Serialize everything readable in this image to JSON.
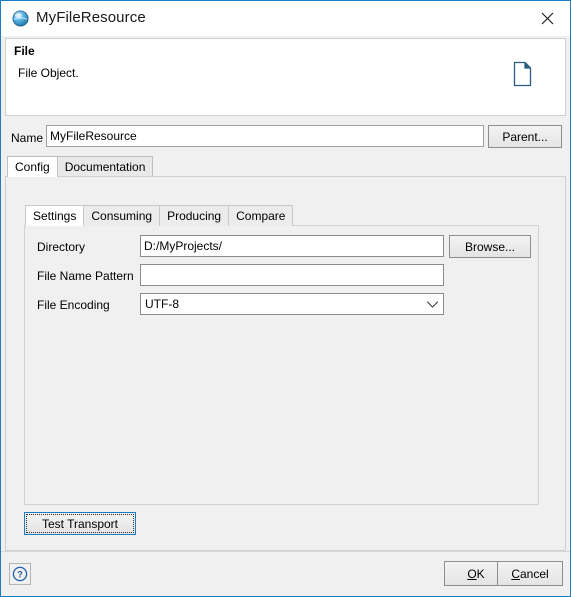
{
  "window": {
    "title": "MyFileResource",
    "icon": "blue-sphere-icon",
    "close_label": "✕",
    "border_color": "#1a7dc4"
  },
  "header": {
    "title": "File",
    "description": "File Object.",
    "icon": "document-page-icon"
  },
  "name_row": {
    "label": "Name",
    "value": "MyFileResource",
    "placeholder": "",
    "parent_button": "Parent..."
  },
  "outer_tabs": [
    {
      "label": "Config",
      "selected": true
    },
    {
      "label": "Documentation",
      "selected": false
    }
  ],
  "inner_tabs": [
    {
      "label": "Settings",
      "selected": true
    },
    {
      "label": "Consuming",
      "selected": false
    },
    {
      "label": "Producing",
      "selected": false
    },
    {
      "label": "Compare",
      "selected": false
    }
  ],
  "settings": {
    "directory": {
      "label": "Directory",
      "value": "D:/MyProjects/",
      "placeholder": "",
      "browse_button": "Browse..."
    },
    "file_name_pattern": {
      "label": "File Name Pattern",
      "value": "",
      "placeholder": ""
    },
    "file_encoding": {
      "label": "File Encoding",
      "value": "UTF-8",
      "arrow_icon": "chevron-down-icon",
      "options": [
        "UTF-8"
      ]
    }
  },
  "test_transport_button": "Test Transport",
  "footer": {
    "help_icon": "help-question-icon",
    "ok": {
      "mnemonic": "O",
      "rest": "K"
    },
    "cancel": {
      "mnemonic": "C",
      "rest": "ancel"
    }
  }
}
